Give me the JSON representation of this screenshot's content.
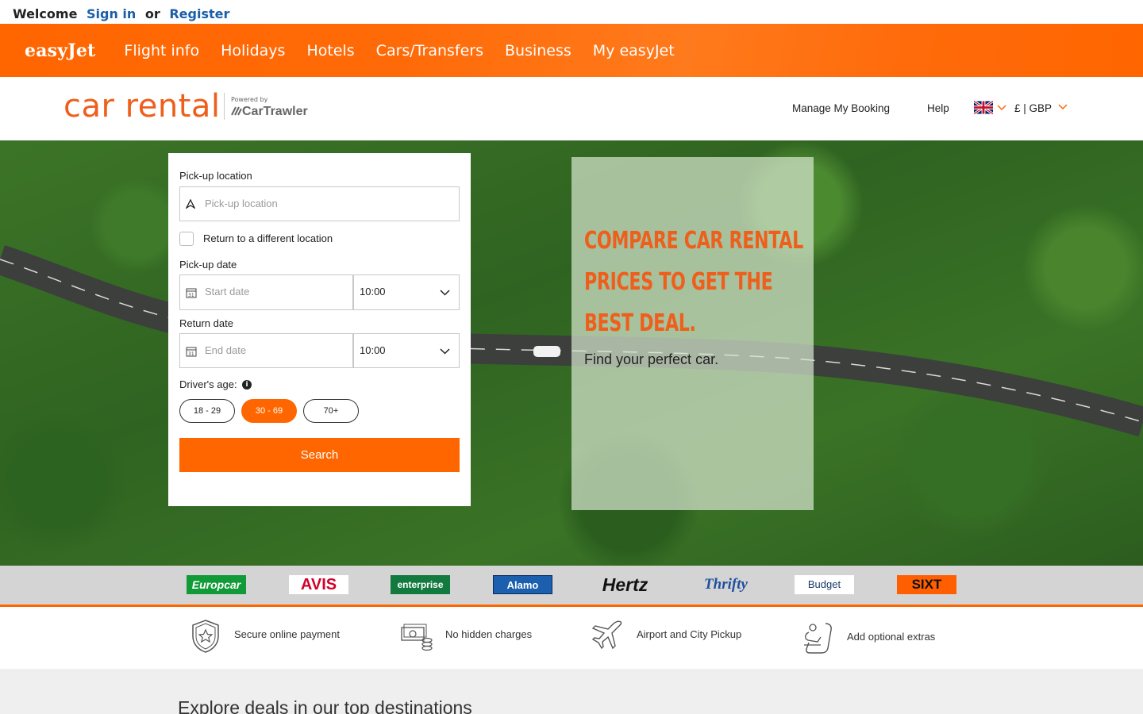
{
  "welcome_bar": {
    "welcome": "Welcome",
    "sign_in": "Sign in",
    "or": "or",
    "register": "Register"
  },
  "nav": {
    "logo": "easyJet",
    "items": [
      {
        "label": "Flight info"
      },
      {
        "label": "Holidays"
      },
      {
        "label": "Hotels"
      },
      {
        "label": "Cars/Transfers"
      },
      {
        "label": "Business"
      },
      {
        "label": "My easyJet"
      }
    ]
  },
  "header": {
    "brand": "car rental",
    "powered_by": "Powered by",
    "partner": "CarTrawler",
    "manage_booking": "Manage My Booking",
    "help": "Help",
    "currency": "£ | GBP",
    "language_flag": "uk-flag-icon"
  },
  "form": {
    "pickup_location_label": "Pick-up location",
    "pickup_location_placeholder": "Pick-up location",
    "return_different": "Return to a different location",
    "pickup_date_label": "Pick-up date",
    "start_date_placeholder": "Start date",
    "pickup_time": "10:00",
    "return_date_label": "Return date",
    "end_date_placeholder": "End date",
    "return_time": "10:00",
    "driver_age_label": "Driver's age:",
    "info_glyph": "i",
    "age_options": [
      {
        "label": "18 - 29",
        "selected": false
      },
      {
        "label": "30 - 69",
        "selected": true
      },
      {
        "label": "70+",
        "selected": false
      }
    ],
    "search_label": "Search"
  },
  "promo": {
    "title_lines": [
      "COMPARE CAR RENTAL",
      "PRICES TO GET THE",
      "BEST DEAL."
    ],
    "subtitle": "Find your perfect car."
  },
  "brands": [
    {
      "name": "Europcar",
      "bg": "#119a38",
      "fg": "#ffffff"
    },
    {
      "name": "AVIS",
      "bg": "#ffffff",
      "fg": "#d4002a"
    },
    {
      "name": "enterprise",
      "bg": "#127a3f",
      "fg": "#ffffff"
    },
    {
      "name": "Alamo",
      "bg": "#1b5fae",
      "fg": "#ffffff"
    },
    {
      "name": "Hertz",
      "bg": "#d4d4d4",
      "fg": "#111111"
    },
    {
      "name": "Thrifty",
      "bg": "#d4d4d4",
      "fg": "#1f4fa0"
    },
    {
      "name": "Budget",
      "bg": "#ffffff",
      "fg": "#1c3a6b"
    },
    {
      "name": "SIXT",
      "bg": "#ff5f00",
      "fg": "#111111"
    }
  ],
  "features": [
    {
      "label": "Secure online payment",
      "icon": "shield-star-icon"
    },
    {
      "label": "No hidden charges",
      "icon": "cash-coins-icon"
    },
    {
      "label": "Airport and City Pickup",
      "icon": "airplane-icon"
    },
    {
      "label": "Add optional extras",
      "icon": "child-seat-icon"
    }
  ],
  "colors": {
    "accent": "#ff6600",
    "brand_text": "#ee5f1c",
    "link": "#1a5fa8"
  },
  "deals": {
    "title": "Explore deals in our top destinations"
  }
}
